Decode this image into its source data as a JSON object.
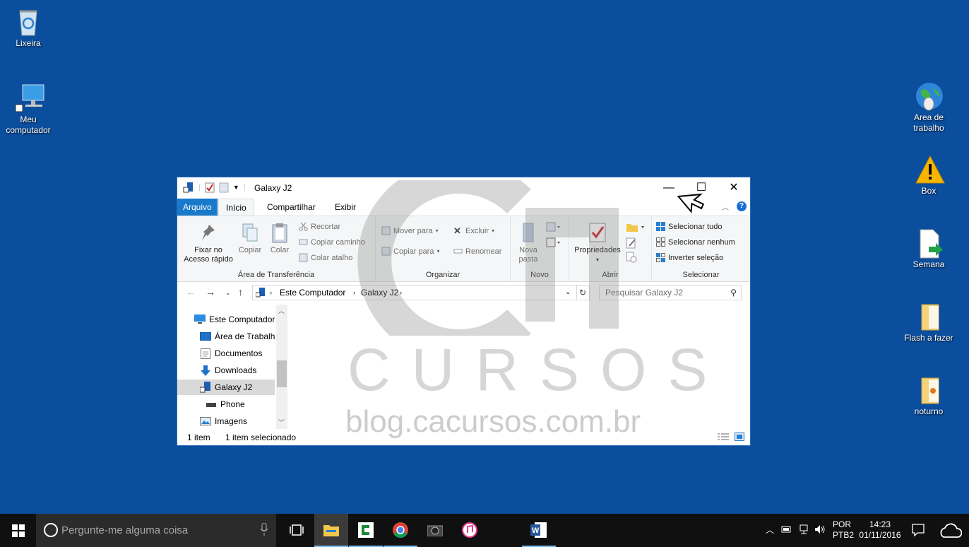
{
  "desktop": {
    "background": "#0b4e9d",
    "icons_left": [
      {
        "label": "Lixeira",
        "icon": "recycle-bin-icon"
      },
      {
        "label": "Meu computador",
        "icon": "computer-icon"
      }
    ],
    "icons_right": [
      {
        "label": "Area de trabalho",
        "icon": "globe-icon"
      },
      {
        "label": "Box",
        "icon": "warning-icon"
      },
      {
        "label": "Semana",
        "icon": "document-arrow-icon"
      },
      {
        "label": "Flash a fazer",
        "icon": "folder-icon"
      },
      {
        "label": "noturno",
        "icon": "folder-icon"
      }
    ]
  },
  "window": {
    "title": "Galaxy J2",
    "controls": {
      "minimize": "—",
      "maximize": "☐",
      "close": "✕"
    },
    "tabs": [
      "Arquivo",
      "Início",
      "Compartilhar",
      "Exibir"
    ],
    "ribbon": {
      "clipboard": {
        "label": "Área de Transferência",
        "pin": "Fixar no Acesso rápido",
        "copy": "Copiar",
        "paste": "Colar",
        "cut": "Recortar",
        "copy_path": "Copiar caminho",
        "paste_shortcut": "Colar atalho"
      },
      "organize": {
        "label": "Organizar",
        "move_to": "Mover para",
        "copy_to": "Copiar para",
        "delete": "Excluir",
        "rename": "Renomear"
      },
      "new": {
        "label": "Novo",
        "new_folder": "Nova pasta"
      },
      "open": {
        "label": "Abrir",
        "properties": "Propriedades"
      },
      "select": {
        "label": "Selecionar",
        "select_all": "Selecionar tudo",
        "select_none": "Selecionar nenhum",
        "invert": "Inverter seleção"
      }
    },
    "address": {
      "crumbs": [
        "Este Computador",
        "Galaxy J2"
      ],
      "search_placeholder": "Pesquisar Galaxy J2"
    },
    "nav": [
      {
        "label": "Este Computador",
        "icon": "computer-icon"
      },
      {
        "label": "Área de Trabalho",
        "icon": "desktop-icon"
      },
      {
        "label": "Documentos",
        "icon": "documents-icon"
      },
      {
        "label": "Downloads",
        "icon": "download-arrow-icon"
      },
      {
        "label": "Galaxy J2",
        "icon": "phone-device-icon",
        "selected": true
      },
      {
        "label": "Phone",
        "icon": "drive-icon"
      },
      {
        "label": "Imagens",
        "icon": "pictures-icon"
      }
    ],
    "status": {
      "items": "1 item",
      "selected": "1 item selecionado"
    }
  },
  "watermark": {
    "site": "blog.cacursos.com.br",
    "brand": "CURSOS"
  },
  "taskbar": {
    "search_placeholder": "Pergunte-me alguma coisa",
    "apps": [
      "file-explorer-icon",
      "camtasia-icon",
      "chrome-icon",
      "camera-icon",
      "itunes-icon",
      "word-icon"
    ],
    "lang_top": "POR",
    "lang_bottom": "PTB2",
    "time": "14:23",
    "date": "01/11/2016"
  }
}
